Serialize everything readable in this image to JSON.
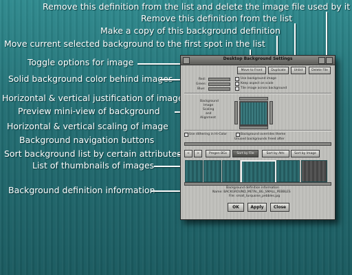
{
  "callouts": {
    "remove_delete": "Remove this definition from the list and delete the image file used by it",
    "remove": "Remove this definition from the list",
    "copy": "Make a copy of this background definition",
    "move_front": "Move current selected background to the first spot in the list",
    "toggle": "Toggle options for image",
    "solid_color": "Solid background color behind images",
    "justification": "Horizontal & vertical justification of image",
    "preview": "Preview mini-view of background",
    "scaling": "Horizontal & vertical scaling of image",
    "nav_buttons": "Background navigation buttons",
    "sort": "Sort background list by certain attributes",
    "thumbnails": "List of thumbnails of images",
    "def_info": "Background definition information"
  },
  "window": {
    "title": "Desktop Background Settings",
    "move_to_front": "Move to Front",
    "duplicate": "Duplicate",
    "unlist": "Unlist",
    "delete_file": "Delete File",
    "red_label": "Red:",
    "green_label": "Green:",
    "blue_label": "Blue:",
    "opt_use_bg_image": "Use background image",
    "opt_keep_aspect": "Keep aspect on scale",
    "opt_tile": "Tile image across background",
    "align_l1": "Background",
    "align_l2": "Image",
    "align_l3": "Scaling",
    "align_l4": "and",
    "align_l5": "Alignment",
    "dither": "Use dithering in Hi-Color",
    "override": "Background overrides theme",
    "freed_after": "Unused backgrounds freed after",
    "nav_prev": "<",
    "nav_next": ">",
    "pregen": "Pregen BGs",
    "sort_filename": "Sort by File",
    "sort_attr": "Sort by Attr.",
    "sort_image": "Sort by Image",
    "info1": "Background definition information",
    "info2": "Name: BACKGROUND_METAL_BG_SMALL_PEBBLES",
    "info3": "File: small_turquoise_pebbles.jpg",
    "ok": "OK",
    "apply": "Apply",
    "close": "Close"
  }
}
